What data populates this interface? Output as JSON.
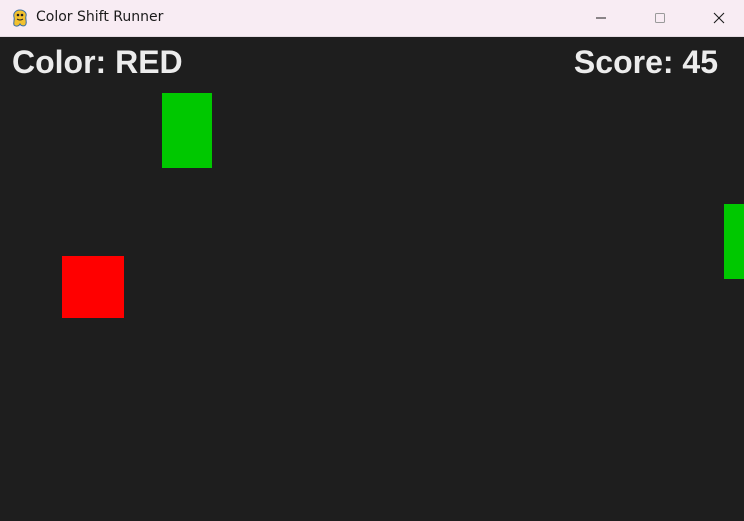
{
  "window": {
    "title": "Color Shift Runner",
    "icon": "pygame-snake-icon",
    "controls": [
      "minimize-icon",
      "maximize-icon",
      "close-icon"
    ]
  },
  "hud": {
    "color_text": "Color: RED",
    "score_text": "Score: 45"
  },
  "colors": {
    "background": "#1e1e1e",
    "hud_text": "#ececec",
    "player": "#ff0000",
    "obstacle": "#00c800",
    "titlebar": "#f8ecf3"
  },
  "game": {
    "player_color": "RED",
    "score": 45,
    "obstacles": [
      {
        "color": "GREEN"
      },
      {
        "color": "GREEN"
      }
    ]
  }
}
